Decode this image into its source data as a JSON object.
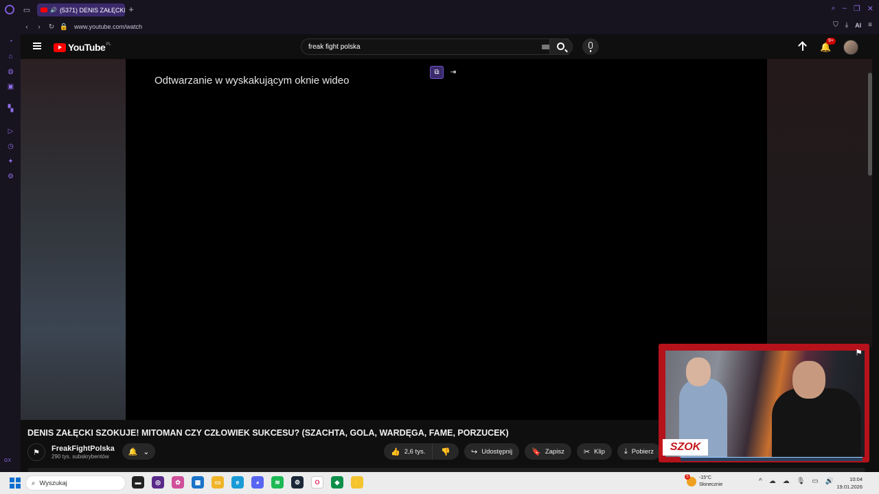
{
  "browser": {
    "tab_title": "(5371) DENIS ZAŁĘCKI",
    "new_tab": "+",
    "url": "www.youtube.com/watch",
    "ai_label": "AI",
    "sidebar_bottom": "GX"
  },
  "youtube": {
    "logo_text": "YouTube",
    "country_code": "PL",
    "search_value": "freak fight polska",
    "notifications_badge": "9+",
    "player_message": "Odtwarzanie w wyskakującym oknie wideo",
    "video_title": "DENIS ZAŁĘCKI SZOKUJE! MITOMAN CZY CZŁOWIEK SUKCESU? (SZACHTA, GOLA, WARDĘGA, FAME, PORZUCEK)",
    "channel_name": "FreakFightPolska",
    "subscribers": "290 tys. subskrybentów",
    "likes": "2,6 tys.",
    "share_label": "Udostępnij",
    "save_label": "Zapisz",
    "clip_label": "Klip",
    "download_label": "Pobierz"
  },
  "mini_player": {
    "overlay_text": "SZOK"
  },
  "taskbar": {
    "search_placeholder": "Wyszukaj",
    "weather_temp": "-15°C",
    "weather_desc": "Słonecznie",
    "weather_badge": "5",
    "time": "10:04",
    "date": "19.01.2026"
  },
  "colors": {
    "youtube_red": "#ff0000",
    "opera_purple": "#8f6ee8",
    "mini_player_frame": "#b5121b"
  }
}
